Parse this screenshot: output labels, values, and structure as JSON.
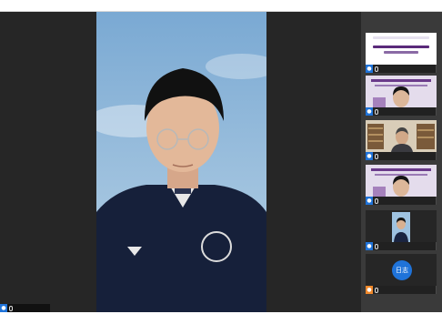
{
  "window": {
    "title": ""
  },
  "main": {
    "speaker_name": ""
  },
  "sidebar": {
    "participants": [
      {
        "name": ""
      },
      {
        "name": ""
      },
      {
        "name": ""
      },
      {
        "name": ""
      },
      {
        "name": ""
      },
      {
        "name": ""
      }
    ],
    "log_button_label": "日志"
  },
  "colors": {
    "accent": "#1f73d9",
    "stage_bg": "#262626",
    "sidebar_bg": "#3a3a3a",
    "orange_badge": "#f0882a"
  }
}
